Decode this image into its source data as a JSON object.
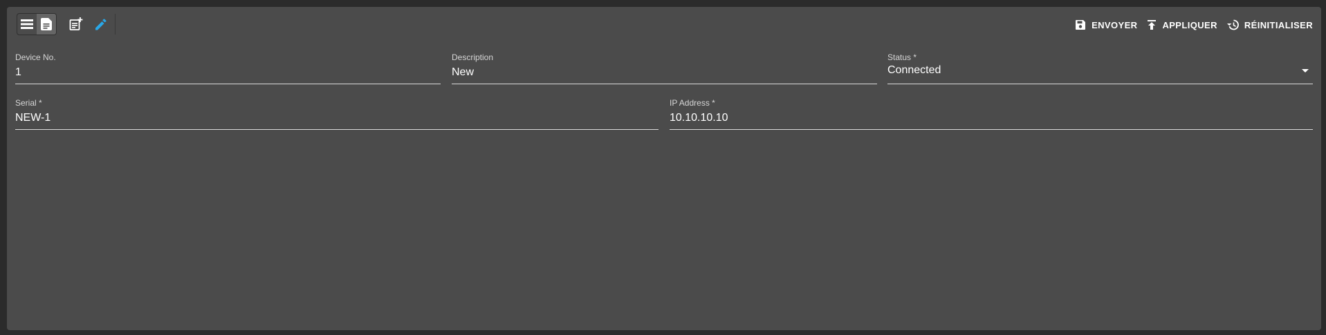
{
  "toolbar": {
    "view_toggle": {
      "list_icon": "list-icon",
      "form_icon": "form-icon",
      "active": "form"
    },
    "new_icon": "note-add-icon",
    "edit_icon": "pencil-icon",
    "edit_icon_color": "#29a8e8",
    "actions": {
      "submit_label": "ENVOYER",
      "apply_label": "APPLIQUER",
      "reset_label": "RÉINITIALISER"
    }
  },
  "form": {
    "device_no": {
      "label": "Device No.",
      "value": "1"
    },
    "description": {
      "label": "Description",
      "value": "New"
    },
    "status": {
      "label": "Status *",
      "value": "Connected"
    },
    "serial": {
      "label": "Serial *",
      "value": "NEW-1"
    },
    "ip_address": {
      "label": "IP Address *",
      "value": "10.10.10.10"
    }
  }
}
